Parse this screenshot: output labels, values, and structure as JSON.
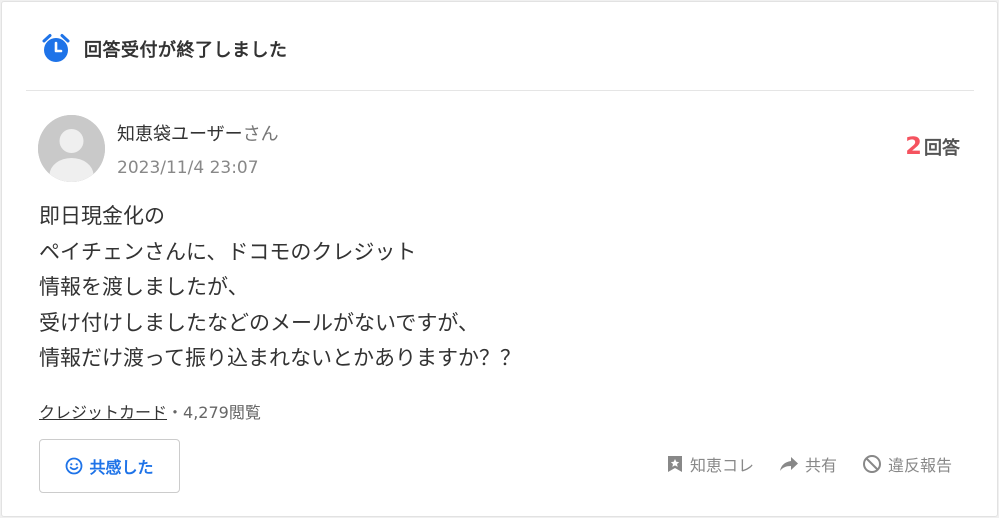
{
  "status": {
    "text": "回答受付が終了しました"
  },
  "question": {
    "user_name": "知恵袋ユーザー",
    "user_suffix": "さん",
    "date": "2023/11/4 23:07",
    "answer_count": "2",
    "answer_label": "回答",
    "body_lines": [
      "即日現金化の",
      "ペイチェンさんに、ドコモのクレジット",
      "情報を渡しましたが、",
      "受け付けしましたなどのメールがないですが、",
      "情報だけ渡って振り込まれないとかありますか？？"
    ],
    "category": "クレジットカード",
    "separator": "・",
    "views": "4,279閲覧"
  },
  "buttons": {
    "empathy": "共感した",
    "chiebukuro_collection": "知恵コレ",
    "share": "共有",
    "report": "違反報告"
  },
  "colors": {
    "accent_blue": "#1e73e8",
    "answer_red": "#f5535f"
  }
}
